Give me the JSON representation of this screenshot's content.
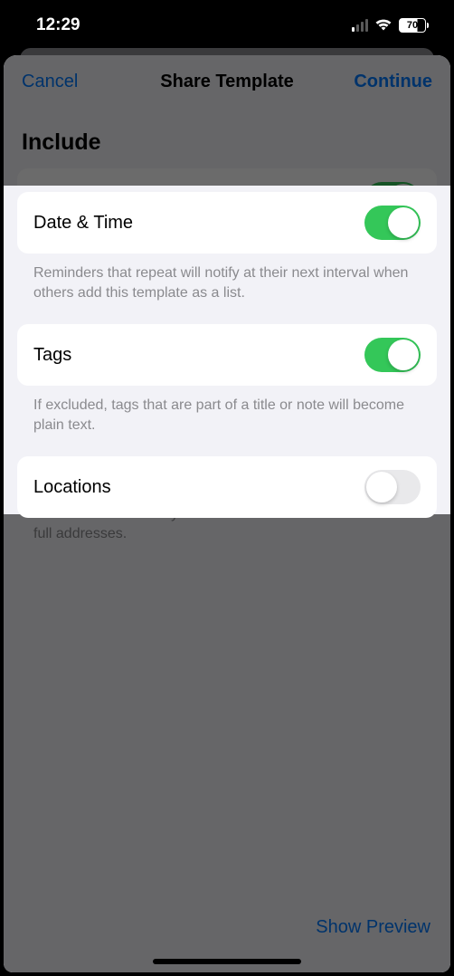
{
  "statusBar": {
    "time": "12:29",
    "battery": "70"
  },
  "nav": {
    "cancel": "Cancel",
    "title": "Share Template",
    "continue": "Continue"
  },
  "sectionTitle": "Include",
  "options": {
    "dateTime": {
      "label": "Date & Time",
      "footer": "Reminders that repeat will notify at their next interval when others add this template as a list.",
      "on": true
    },
    "tags": {
      "label": "Tags",
      "footer": "If excluded, tags that are part of a title or note will become plain text.",
      "on": true
    },
    "locations": {
      "label": "Locations",
      "footer": "Named locations like your home and work will be shown as full addresses.",
      "on": false
    }
  },
  "footerLink": "Show Preview"
}
